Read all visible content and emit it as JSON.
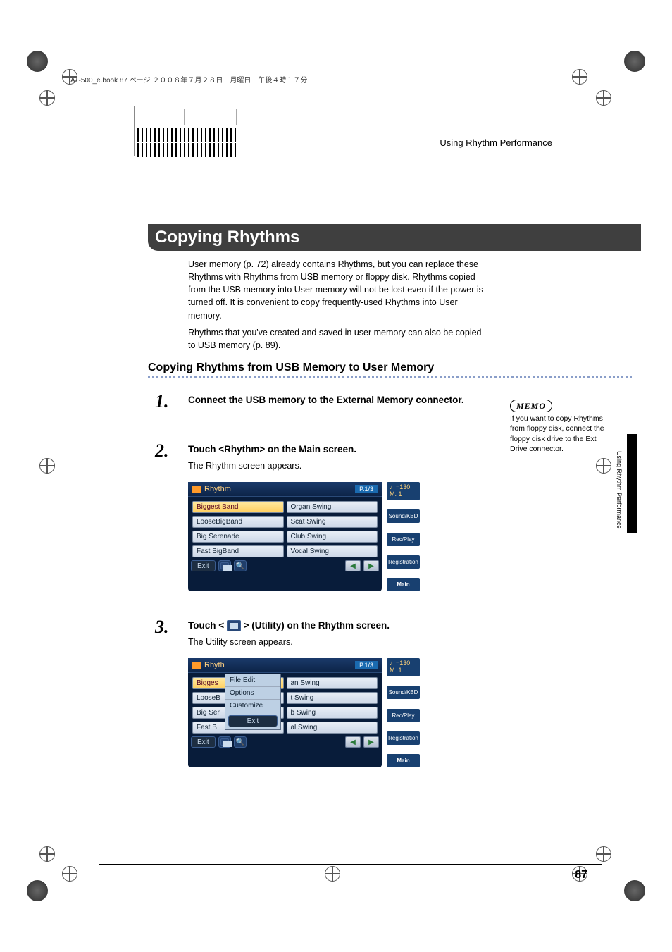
{
  "header_line": "AT-500_e.book  87 ページ  ２００８年７月２８日　月曜日　午後４時１７分",
  "section_name": "Using Rhythm Performance",
  "side_text": "Using Rhythm Performance",
  "title": "Copying Rhythms",
  "intro_p1": "User memory (p. 72) already contains Rhythms, but you can replace these Rhythms with Rhythms from USB memory or floppy disk. Rhythms copied from the USB memory into User memory will not be lost even if the power is turned off. It is convenient to copy frequently-used Rhythms into User memory.",
  "intro_p2": "Rhythms that you've created and saved in user memory can also be copied to USB memory (p. 89).",
  "h2": "Copying Rhythms from USB Memory to User Memory",
  "step1": {
    "num": "1.",
    "bold": "Connect the USB memory to the External Memory connector."
  },
  "step2": {
    "num": "2.",
    "bold": "Touch <Rhythm> on the Main screen.",
    "sub": "The Rhythm screen appears."
  },
  "step3": {
    "num": "3.",
    "bold_pre": "Touch < ",
    "bold_post": " > (Utility) on the Rhythm screen.",
    "sub": "The Utility screen appears."
  },
  "screen1": {
    "title": "Rhythm",
    "page": "P.1/3",
    "cells": [
      "Biggest Band",
      "Organ Swing",
      "LooseBigBand",
      "Scat Swing",
      "Big Serenade",
      "Club Swing",
      "Fast BigBand",
      "Vocal Swing"
    ],
    "exit": "Exit",
    "tempo": "♩=130",
    "tempo2": "M:     1",
    "tabs": [
      "Sound/KBD",
      "Rec/Play",
      "Registration",
      "Main"
    ]
  },
  "screen2": {
    "title": "Rhyth",
    "page": "P.1/3",
    "cells_partial": [
      "Bigges",
      "an Swing",
      "LooseB",
      "t Swing",
      "Big Ser",
      "b Swing",
      "Fast B",
      "al Swing"
    ],
    "dropdown": [
      "File Edit",
      "Options",
      "Customize"
    ],
    "dd_exit": "Exit",
    "exit": "Exit",
    "tempo": "♩=130",
    "tempo2": "M:     1",
    "tabs": [
      "Sound/KBD",
      "Rec/Play",
      "Registration",
      "Main"
    ]
  },
  "memo": {
    "label": "MEMO",
    "text": "If you want to copy Rhythms from floppy disk, connect the floppy disk drive to the Ext Drive connector."
  },
  "page_num": "87"
}
